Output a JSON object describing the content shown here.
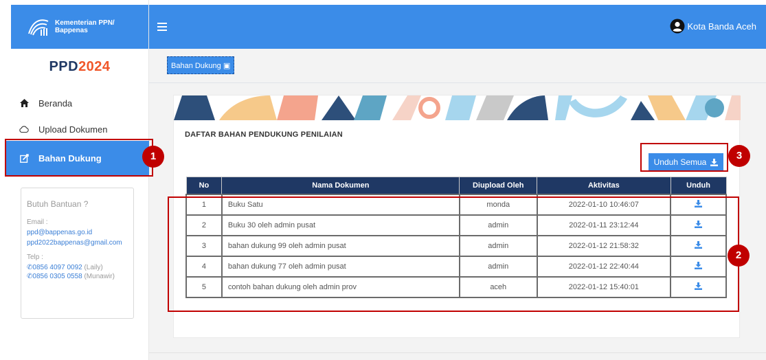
{
  "brand": {
    "line1": "Kementerian PPN/",
    "line2": "Bappenas"
  },
  "app_title": {
    "part1": "PPD",
    "part2": "2024"
  },
  "nav": {
    "home": "Beranda",
    "upload": "Upload Dokumen",
    "bahan": "Bahan Dukung"
  },
  "help": {
    "title": "Butuh Bantuan ?",
    "email_label": "Email :",
    "emails": [
      "ppd@bappenas.go.id",
      "ppd2022bappenas@gmail.com"
    ],
    "phone_label": "Telp :",
    "phones": [
      {
        "number": "0856 4097 0092",
        "name": "(Laily)"
      },
      {
        "number": "0856 0305 0558",
        "name": "(Munawir)"
      }
    ]
  },
  "topbar": {
    "user": "Kota Banda Aceh"
  },
  "breadcrumb": "Bahan Dukung",
  "card": {
    "title": "DAFTAR BAHAN PENDUKUNG PENILAIAN",
    "download_all": "Unduh Semua"
  },
  "table": {
    "headers": [
      "No",
      "Nama Dokumen",
      "Diupload Oleh",
      "Aktivitas",
      "Unduh"
    ],
    "rows": [
      {
        "no": "1",
        "nama": "Buku Satu",
        "oleh": "monda",
        "aktivitas": "2022-01-10 10:46:07"
      },
      {
        "no": "2",
        "nama": "Buku 30 oleh admin pusat",
        "oleh": "admin",
        "aktivitas": "2022-01-11 23:12:44"
      },
      {
        "no": "3",
        "nama": "bahan dukung 99 oleh admin pusat",
        "oleh": "admin",
        "aktivitas": "2022-01-12 21:58:32"
      },
      {
        "no": "4",
        "nama": "bahan dukung 77 oleh admin pusat",
        "oleh": "admin",
        "aktivitas": "2022-01-12 22:40:44"
      },
      {
        "no": "5",
        "nama": "contoh bahan dukung oleh admin prov",
        "oleh": "aceh",
        "aktivitas": "2022-01-12 15:40:01"
      }
    ]
  },
  "annotations": {
    "m1": "1",
    "m2": "2",
    "m3": "3"
  },
  "colors": {
    "primary": "#3b8ce8",
    "header": "#1f3864",
    "accent": "#f0572a",
    "annotation": "#c00000"
  },
  "icons": [
    "logo-icon",
    "menu-icon",
    "user-icon",
    "home-icon",
    "cloud-icon",
    "edit-icon",
    "download-icon"
  ]
}
